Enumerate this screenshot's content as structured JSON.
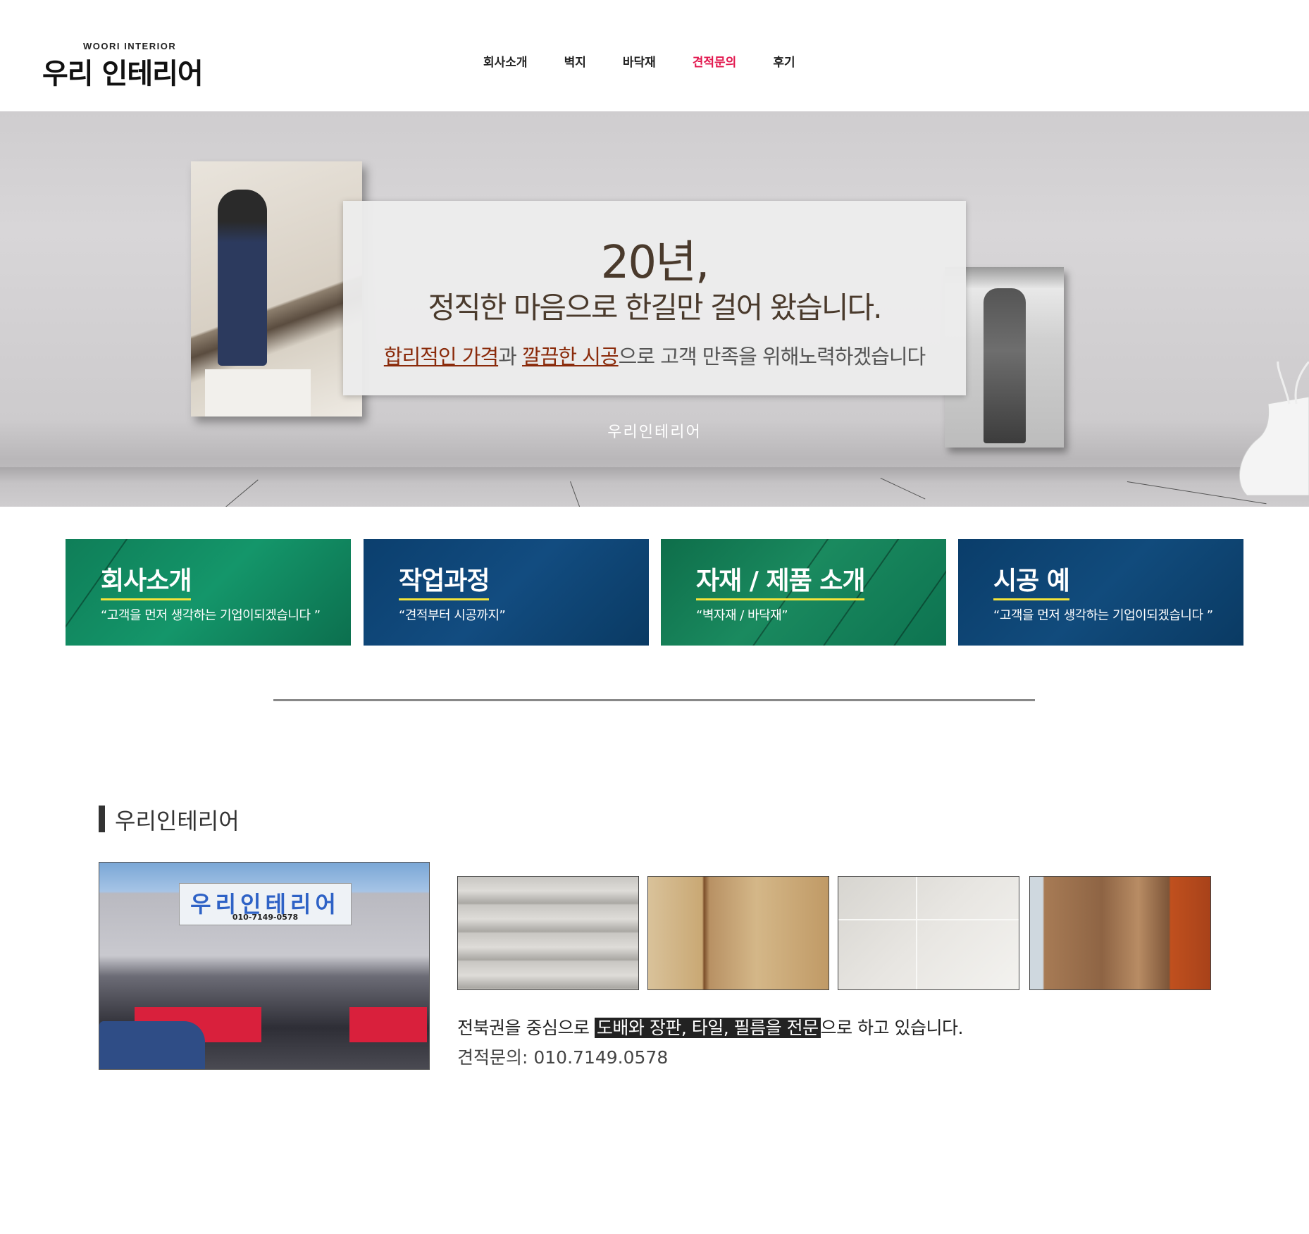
{
  "header": {
    "logo_sub": "WOORI INTERIOR",
    "logo_main": "우리 인테리어",
    "nav": [
      {
        "label": "회사소개",
        "active": false
      },
      {
        "label": "벽지",
        "active": false
      },
      {
        "label": "바닥재",
        "active": false
      },
      {
        "label": "견적문의",
        "active": true
      },
      {
        "label": "후기",
        "active": false
      }
    ],
    "active_color": "#e2174e"
  },
  "hero": {
    "title": "20년,",
    "subtitle": "정직한 마음으로 한길만 걸어 왔습니다.",
    "line_hl1": "합리적인 가격",
    "line_mid": "과 ",
    "line_hl2": "깔끔한 시공",
    "line_end": "으로 고객 만족을 위해노력하겠습니다",
    "caption": "우리인테리어"
  },
  "cards": [
    {
      "title": "회사소개",
      "desc": "“고객을 먼저 생각하는 기업이되겠습니다 ”",
      "color": "#14966a"
    },
    {
      "title": "작업과정",
      "desc": "“견적부터 시공까지”",
      "color": "#124c80"
    },
    {
      "title": "자재 / 제품 소개",
      "desc": "“벽자재 / 바닥재”",
      "color": "#1a8a5f"
    },
    {
      "title": "시공 예",
      "desc": "“고객을 먼저 생각하는 기업이되겠습니다 ”",
      "color": "#114b7c"
    }
  ],
  "about": {
    "section_title": "우리인테리어",
    "shop_sign": "우리인테리어",
    "shop_phone": "010-7149-0578",
    "desc_start": "전북권을 중심으로 ",
    "desc_hl": "도배와 장판, 타일, 필름을 전문",
    "desc_end": "으로 하고 있습니다.",
    "contact": "견적문의: 010.7149.0578"
  }
}
